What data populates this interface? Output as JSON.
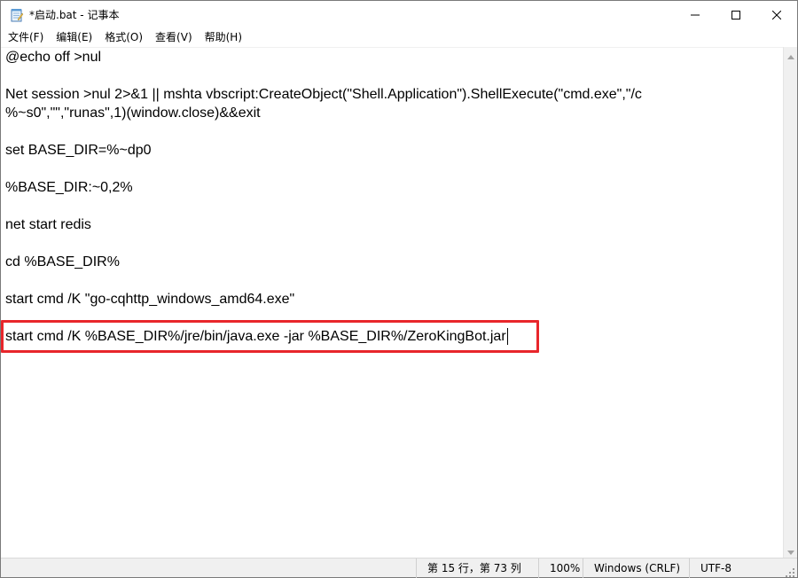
{
  "window": {
    "title": "*启动.bat - 记事本"
  },
  "menu": {
    "items": [
      {
        "label": "文件(F)"
      },
      {
        "label": "编辑(E)"
      },
      {
        "label": "格式(O)"
      },
      {
        "label": "查看(V)"
      },
      {
        "label": "帮助(H)"
      }
    ]
  },
  "editor": {
    "lines": [
      "@echo off >nul",
      "",
      "Net session >nul 2>&1 || mshta vbscript:CreateObject(\"Shell.Application\").ShellExecute(\"cmd.exe\",\"/c",
      "%~s0\",\"\",\"runas\",1)(window.close)&&exit",
      "",
      "set BASE_DIR=%~dp0",
      "",
      "%BASE_DIR:~0,2%",
      "",
      "net start redis",
      "",
      "cd %BASE_DIR%",
      "",
      "start cmd /K \"go-cqhttp_windows_amd64.exe\"",
      "",
      "start cmd /K %BASE_DIR%/jre/bin/java.exe -jar %BASE_DIR%/ZeroKingBot.jar"
    ],
    "highlighted_line_index": 15,
    "highlight_color": "#e8262b"
  },
  "status": {
    "position": "第 15 行，第 73 列",
    "zoom": "100%",
    "line_ending": "Windows (CRLF)",
    "encoding": "UTF-8"
  },
  "icons": {
    "app": "notepad-icon",
    "minimize": "minimize-icon",
    "maximize": "maximize-icon",
    "close": "close-icon"
  }
}
